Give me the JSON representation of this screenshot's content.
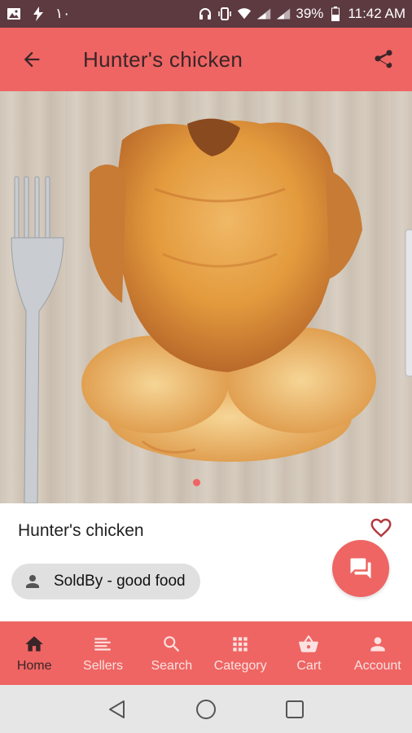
{
  "status_bar": {
    "left_text": "١٠",
    "battery": "39%",
    "time": "11:42 AM"
  },
  "app_bar": {
    "title": "Hunter's chicken"
  },
  "product": {
    "name": "Hunter's chicken",
    "seller_label": "SoldBy - good food"
  },
  "bottom_nav": {
    "items": [
      {
        "label": "Home",
        "icon": "home-icon",
        "active": true
      },
      {
        "label": "Sellers",
        "icon": "sellers-list-icon"
      },
      {
        "label": "Search",
        "icon": "search-icon"
      },
      {
        "label": "Category",
        "icon": "category-grid-icon"
      },
      {
        "label": "Cart",
        "icon": "cart-basket-icon"
      },
      {
        "label": "Account",
        "icon": "account-icon"
      }
    ]
  },
  "colors": {
    "primary": "#ee6563",
    "status_bar": "#5c3a40",
    "chip": "#e0e0e0"
  }
}
